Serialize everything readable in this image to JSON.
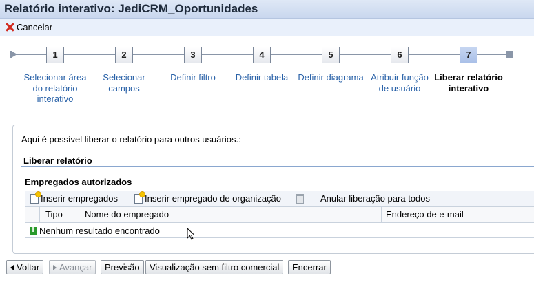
{
  "window": {
    "title": "Relatório interativo: JediCRM_Oportunidades"
  },
  "toolbar": {
    "cancel_label": "Cancelar"
  },
  "wizard": {
    "steps": [
      {
        "number": "1",
        "label": "Selecionar área do relatório interativo"
      },
      {
        "number": "2",
        "label": "Selecionar campos"
      },
      {
        "number": "3",
        "label": "Definir filtro"
      },
      {
        "number": "4",
        "label": "Definir tabela"
      },
      {
        "number": "5",
        "label": "Definir diagrama"
      },
      {
        "number": "6",
        "label": "Atribuir função de usuário"
      },
      {
        "number": "7",
        "label": "Liberar relatório interativo"
      }
    ],
    "active_step": 7
  },
  "content": {
    "intro": "Aqui é possível liberar o relatório para outros usuários.:",
    "release_section": "Liberar relatório",
    "employees_section": "Empregados autorizados",
    "table_toolbar": {
      "insert_employees": "Inserir empregados",
      "insert_org_employee": "Inserir empregado de organização",
      "cancel_release": "Anular liberação para todos"
    },
    "columns": [
      "Tipo",
      "Nome do empregado",
      "Endereço de e-mail"
    ],
    "empty_message": "Nenhum resultado encontrado"
  },
  "footer": {
    "back": "Voltar",
    "next": "Avançar",
    "preview": "Previsão",
    "view_no_filter": "Visualização sem filtro comercial",
    "finish": "Encerrar"
  },
  "colors": {
    "link": "#2a62a8",
    "title_bar": "#c9d7ee",
    "section_line": "#8aa7cf"
  }
}
